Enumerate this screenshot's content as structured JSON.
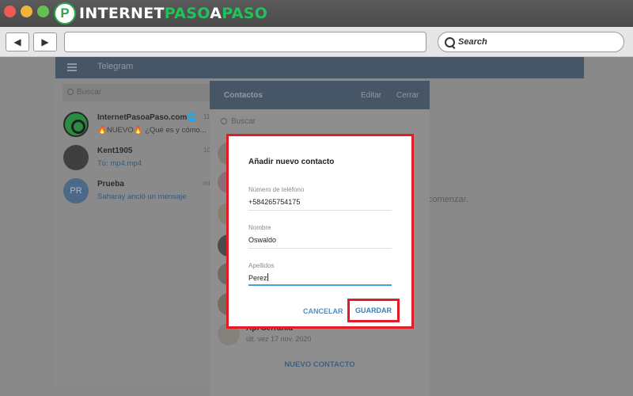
{
  "brand": {
    "name_part1": "INTERNET",
    "name_part2": "PASO",
    "name_part3": "A",
    "name_part4": "PASO",
    "logo_letter": "P"
  },
  "toolbar": {
    "back_symbol": "◀",
    "forward_symbol": "▶",
    "url_value": "",
    "search_label": "Search"
  },
  "telegram": {
    "header_title": "Telegram",
    "search_placeholder": "Buscar",
    "start_text": "comenzar.",
    "chats": [
      {
        "name": "InternetPasoaPaso.com🌐",
        "message": "🔥NUEVO🔥 ¿Qué es y cómo...",
        "time": "11:23"
      },
      {
        "name": "Kent1905",
        "message": "Tú: mp4.mp4",
        "time": "10:24"
      },
      {
        "name": "Prueba",
        "message": "Saharay ancló un mensaje",
        "time": "mié.",
        "initials": "PR"
      }
    ]
  },
  "contacts_panel": {
    "title": "Contactos",
    "edit_label": "Editar",
    "close_label": "Cerrar",
    "search_placeholder": "Buscar",
    "last_contact_name": "Api Serrania",
    "last_contact_seen": "últ. vez 17 nov. 2020",
    "new_contact_label": "NUEVO CONTACTO"
  },
  "modal": {
    "title": "Añadir nuevo contacto",
    "phone_label": "Número de teléfono",
    "phone_value": "+584265754175",
    "name_label": "Nombre",
    "name_value": "Oswaldo",
    "surname_label": "Apellidos",
    "surname_value": "Perez",
    "cancel_label": "CANCELAR",
    "save_label": "GUARDAR"
  },
  "colors": {
    "highlight": "#e11c25",
    "telegram_header": "#475667",
    "link_blue": "#4c90c6",
    "input_focus": "#4b9fd9"
  }
}
